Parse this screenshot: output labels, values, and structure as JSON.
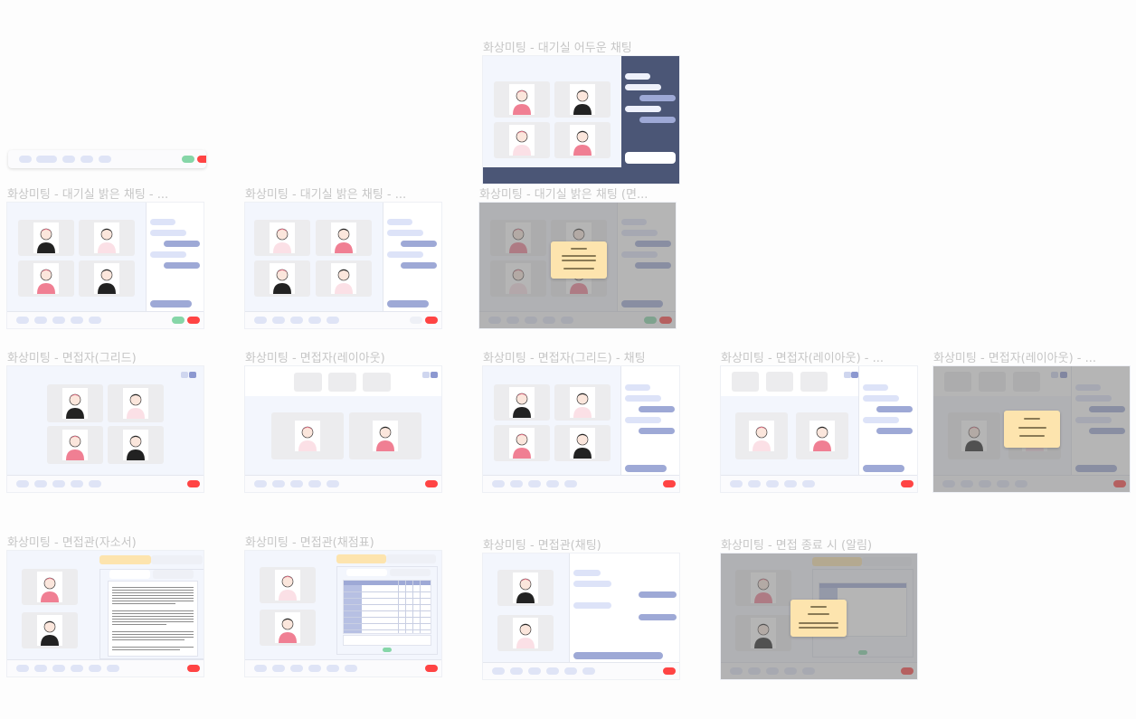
{
  "frames": {
    "dark_chat": {
      "title": "화상미팅 - 대기실 어두운 채팅"
    },
    "bright_chat_1": {
      "title": "화상미팅 - 대기실 밝은 채팅 - ..."
    },
    "bright_chat_2": {
      "title": "화상미팅 - 대기실 밝은 채팅 - ..."
    },
    "bright_chat_modal": {
      "title": "화상미팅 - 대기실 밝은 채팅 (면..."
    },
    "interviewee_grid": {
      "title": "화상미팅 - 면접자(그리드)"
    },
    "interviewee_layout": {
      "title": "화상미팅 - 면접자(레이아웃)"
    },
    "interviewee_grid_chat": {
      "title": "화상미팅 - 면접자(그리드) - 채팅"
    },
    "interviewee_layout_chat": {
      "title": "화상미팅 - 면접자(레이아웃) - ..."
    },
    "interviewee_layout_modal": {
      "title": "화상미팅 - 면접자(레이아웃) - ..."
    },
    "interviewer_resume": {
      "title": "화상미팅 - 면접관(자소서)"
    },
    "interviewer_score": {
      "title": "화상미팅 - 면접관(채점표)"
    },
    "interviewer_chat": {
      "title": "화상미팅 - 면접관(채팅)"
    },
    "interview_end": {
      "title": "화상미팅 - 면접 종료 시 (알림)"
    }
  },
  "colors": {
    "end_button": "#ff4444",
    "ready_button": "#86d6a8",
    "chat_bubble_out": "#9ea9d6",
    "chat_bubble_in": "#dde3f8",
    "modal": "#fde4ae",
    "dark_chat_bg": "#4b5676",
    "frame_bg": "#f3f6fd"
  }
}
